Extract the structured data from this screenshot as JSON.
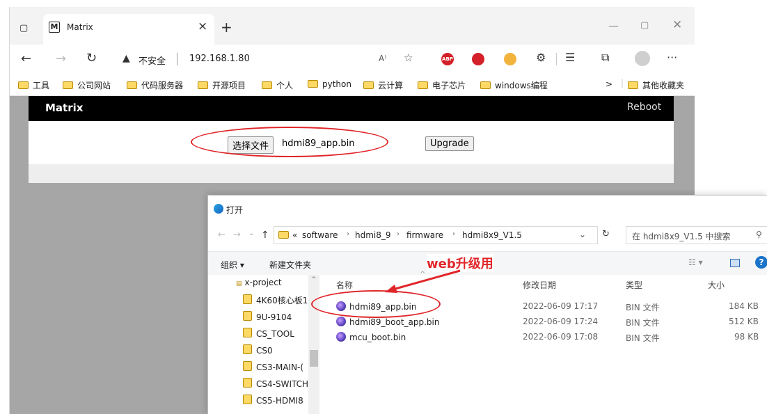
{
  "browser": {
    "tab_title": "Matrix",
    "tab_icon": "M",
    "address": "192.168.1.80",
    "security": "不安全",
    "read_aloud": "A⁾",
    "bookmarks": [
      "工具",
      "公司网站",
      "代码服务器",
      "开源项目",
      "个人",
      "python",
      "云计算",
      "电子芯片",
      "windows编程"
    ],
    "other_bookmarks": "其他收藏夹",
    "overflow": ">"
  },
  "page": {
    "brand": "Matrix",
    "reboot": "Reboot",
    "choose_file": "选择文件",
    "file_name": "hdmi89_app.bin",
    "upgrade": "Upgrade"
  },
  "dialog": {
    "title": "打开",
    "breadcrumb": [
      "software",
      "hdmi8_9",
      "firmware",
      "hdmi8x9_V1.5"
    ],
    "breadcrumb_prefix": "«",
    "search_placeholder": "在 hdmi8x9_V1.5 中搜索",
    "organize": "组织 ▾",
    "new_folder": "新建文件夹",
    "annotation": "web升级用",
    "columns": {
      "name": "名称",
      "date": "修改日期",
      "type": "类型",
      "size": "大小"
    },
    "nav_items": [
      "x-project",
      "4K60核心板1",
      "9U-9104",
      "CS_TOOL",
      "CS0",
      "CS3-MAIN-(",
      "CS4-SWITCH",
      "CS5-HDMI8"
    ],
    "files": [
      {
        "name": "hdmi89_app.bin",
        "date": "2022-06-09 17:17",
        "type": "BIN 文件",
        "size": "184 KB"
      },
      {
        "name": "hdmi89_boot_app.bin",
        "date": "2022-06-09 17:24",
        "type": "BIN 文件",
        "size": "512 KB"
      },
      {
        "name": "mcu_boot.bin",
        "date": "2022-06-09 17:08",
        "type": "BIN 文件",
        "size": "98 KB"
      }
    ]
  },
  "colors": {
    "accent_red": "#e0262a",
    "app_bar": "#000000",
    "page_bg": "#a6a6a6"
  }
}
